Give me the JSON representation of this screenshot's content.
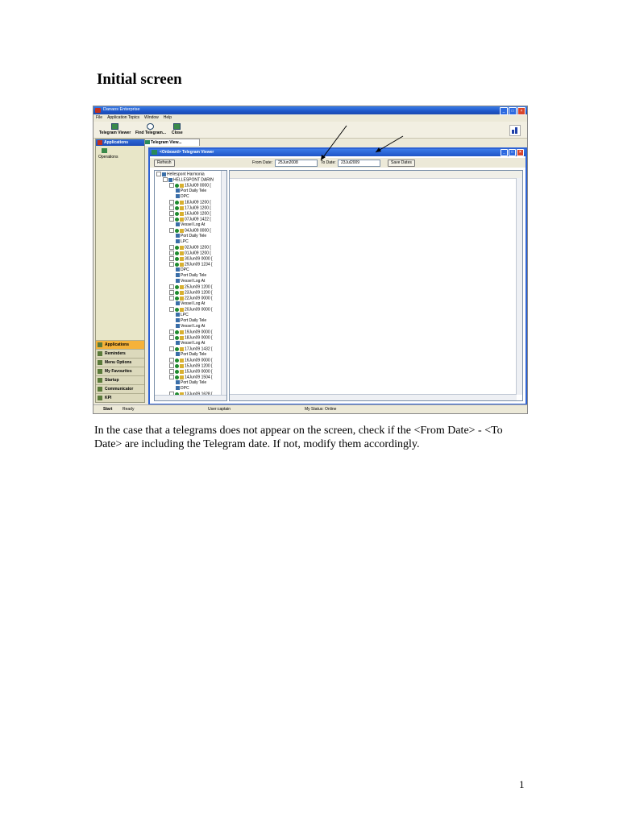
{
  "doc": {
    "title": "Initial screen",
    "body": "In the case that a telegrams does not appear on the screen, check if the <From Date> - <To Date> are including the Telegram date. If not, modify them accordingly.",
    "page_number": "1"
  },
  "app": {
    "title": "Danaos Enterprise",
    "menu": [
      "File",
      "Application Topics",
      "Window",
      "Help"
    ],
    "toolbar": [
      "Telegram Viewer",
      "Find Telegram...",
      "Close"
    ],
    "open_tab": "Telegram View...",
    "left_panel": {
      "header": "Applications",
      "section": "Operations",
      "items": [
        "Applications",
        "Reminders",
        "Menu Options",
        "My Favourites",
        "Startup",
        "Communicator",
        "KPI"
      ]
    },
    "status": {
      "start": "Start",
      "ready": "Ready",
      "user": "User:captain",
      "my_status": "My Status: Online"
    }
  },
  "viewer": {
    "title": "<Onboard> Telegram Viewer",
    "refresh": "Refresh",
    "from_label": "From Date:",
    "from_value": "25Jun2008",
    "to_label": "To Date:",
    "to_value": "23Jul2009",
    "save_dates": "Save Dates",
    "tree": [
      {
        "text": "Hellespont Harmonia",
        "level": 0,
        "icon": "folder"
      },
      {
        "text": "HELLESPONT DARIN",
        "level": 1,
        "icon": "vessel"
      },
      {
        "text": "15Jul09 0000 [",
        "level": 2,
        "icon": "ok"
      },
      {
        "text": "Port Daily Tele",
        "level": 3,
        "icon": "doc"
      },
      {
        "text": "DPC",
        "level": 3,
        "icon": "doc"
      },
      {
        "text": "18Jul09 1200 [",
        "level": 2,
        "icon": "ok"
      },
      {
        "text": "17Jul09 1200 [",
        "level": 2,
        "icon": "ok"
      },
      {
        "text": "16Jul09 1200 [",
        "level": 2,
        "icon": "ok"
      },
      {
        "text": "07Jul09 1422 [",
        "level": 2,
        "icon": "ok"
      },
      {
        "text": "Vessel Log At",
        "level": 3,
        "icon": "doc"
      },
      {
        "text": "04Jul09 0000 [",
        "level": 2,
        "icon": "ok"
      },
      {
        "text": "Port Daily Tele",
        "level": 3,
        "icon": "doc"
      },
      {
        "text": "LPC",
        "level": 3,
        "icon": "doc"
      },
      {
        "text": "02Jul09 1200 [",
        "level": 2,
        "icon": "ok"
      },
      {
        "text": "01Jul09 1200 [",
        "level": 2,
        "icon": "ok"
      },
      {
        "text": "30Jun09 0000 [",
        "level": 2,
        "icon": "ok"
      },
      {
        "text": "29Jun09 1234 [",
        "level": 2,
        "icon": "ok"
      },
      {
        "text": "DPC",
        "level": 3,
        "icon": "doc"
      },
      {
        "text": "Port Daily Tele",
        "level": 3,
        "icon": "doc"
      },
      {
        "text": "Vessel Log At",
        "level": 3,
        "icon": "doc"
      },
      {
        "text": "25Jun09 1200 [",
        "level": 2,
        "icon": "ok"
      },
      {
        "text": "23Jun09 1200 [",
        "level": 2,
        "icon": "ok"
      },
      {
        "text": "22Jun09 0000 [",
        "level": 2,
        "icon": "ok"
      },
      {
        "text": "Vessel Log At",
        "level": 3,
        "icon": "doc"
      },
      {
        "text": "20Jun09 0000 [",
        "level": 2,
        "icon": "ok"
      },
      {
        "text": "LPC",
        "level": 3,
        "icon": "doc"
      },
      {
        "text": "Port Daily Tele",
        "level": 3,
        "icon": "doc"
      },
      {
        "text": "Vessel Log At",
        "level": 3,
        "icon": "doc"
      },
      {
        "text": "19Jun09 0000 [",
        "level": 2,
        "icon": "ok"
      },
      {
        "text": "18Jun09 0000 [",
        "level": 2,
        "icon": "ok"
      },
      {
        "text": "Vessel Log At",
        "level": 3,
        "icon": "doc"
      },
      {
        "text": "17Jun09 1432 [",
        "level": 2,
        "icon": "ok"
      },
      {
        "text": "Port Daily Tele",
        "level": 3,
        "icon": "doc"
      },
      {
        "text": "16Jun09 0000 [",
        "level": 2,
        "icon": "ok"
      },
      {
        "text": "15Jun09 1200 [",
        "level": 2,
        "icon": "ok"
      },
      {
        "text": "15Jun09 0000 [",
        "level": 2,
        "icon": "ok"
      },
      {
        "text": "14Jun09 1504 [",
        "level": 2,
        "icon": "ok"
      },
      {
        "text": "Port Daily Tele",
        "level": 3,
        "icon": "doc"
      },
      {
        "text": "DPC",
        "level": 3,
        "icon": "doc"
      },
      {
        "text": "13Jun09 1628 [",
        "level": 2,
        "icon": "ok"
      }
    ]
  }
}
